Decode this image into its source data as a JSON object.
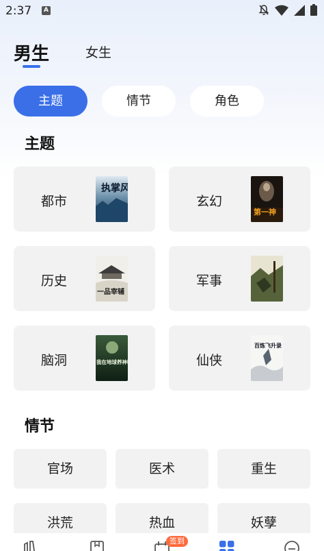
{
  "status_bar": {
    "time": "2:37",
    "notification_letter": "A",
    "icons": [
      "notifications-off-icon",
      "wifi-icon",
      "signal-icon",
      "battery-icon"
    ]
  },
  "gender_tabs": [
    {
      "label": "男生",
      "active": true
    },
    {
      "label": "女生",
      "active": false
    }
  ],
  "filter_pills": [
    {
      "label": "主题",
      "active": true
    },
    {
      "label": "情节",
      "active": false
    },
    {
      "label": "角色",
      "active": false
    }
  ],
  "theme_section": {
    "title": "主题",
    "cards": [
      {
        "label": "都市",
        "cover_title": "执掌风云"
      },
      {
        "label": "玄幻",
        "cover_title": "第一神"
      },
      {
        "label": "历史",
        "cover_title": "一品宰辅"
      },
      {
        "label": "军事",
        "cover_title": ""
      },
      {
        "label": "脑洞",
        "cover_title": "我在地球养神明"
      },
      {
        "label": "仙侠",
        "cover_title": "百炼飞升录"
      }
    ]
  },
  "plot_section": {
    "title": "情节",
    "chips": [
      "官场",
      "医术",
      "重生",
      "洪荒",
      "热血",
      "妖孽"
    ]
  },
  "bottom_nav": {
    "items": [
      "bookshelf-icon",
      "bookstore-icon",
      "checkin-icon",
      "category-icon",
      "profile-icon"
    ],
    "checkin_badge": "签到"
  },
  "colors": {
    "accent": "#3a6fe8",
    "card_bg": "#f2f2f2",
    "badge": "#ff6a3c"
  }
}
